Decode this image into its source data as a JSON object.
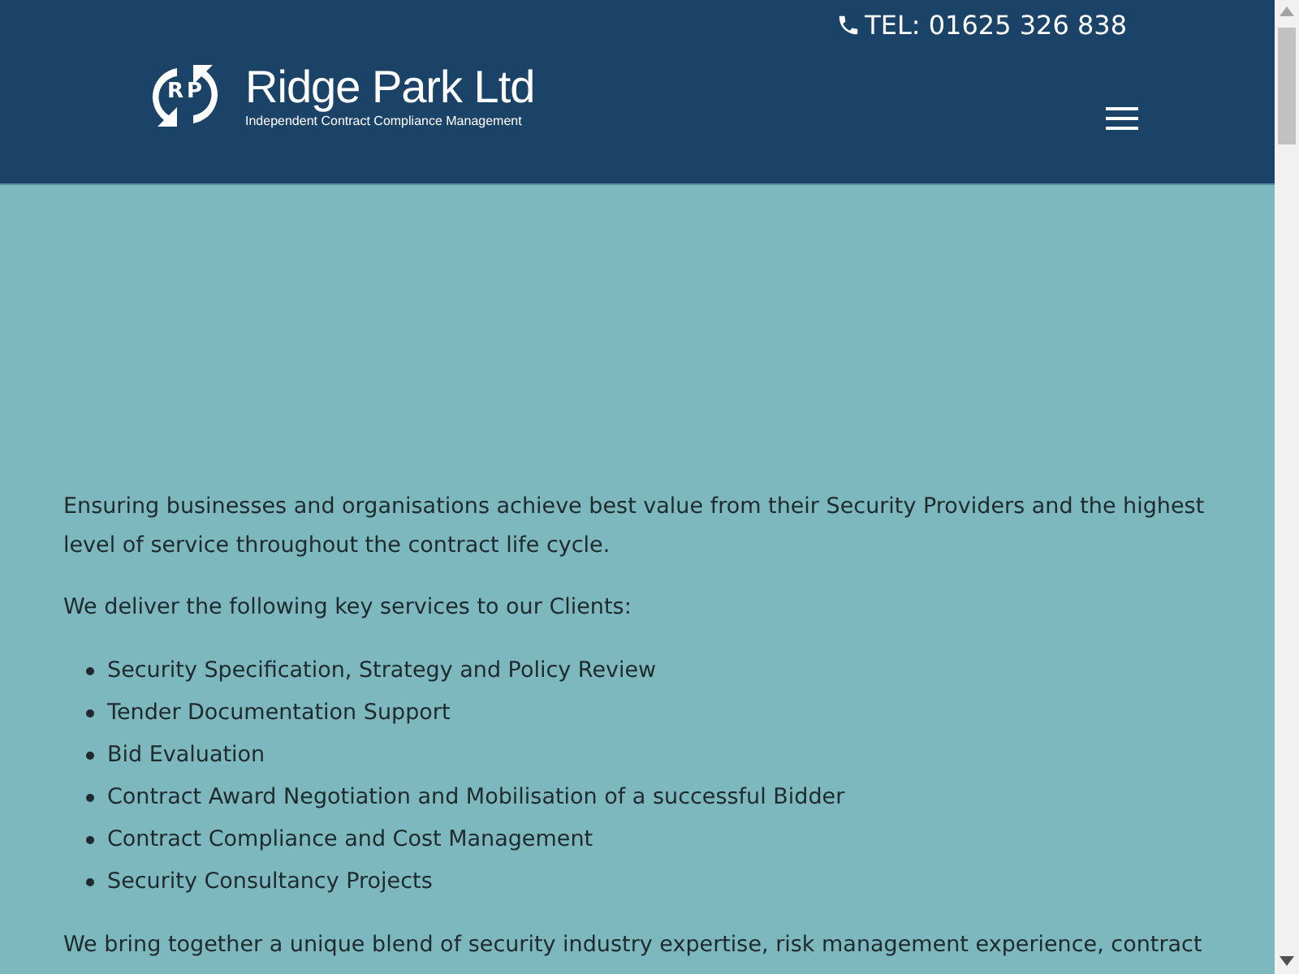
{
  "header": {
    "phone": "TEL: 01625 326 838",
    "logo": {
      "monogram_left": "R",
      "monogram_right": "P",
      "name": "Ridge Park Ltd",
      "tagline": "Independent Contract Compliance Management"
    }
  },
  "content": {
    "intro": "Ensuring businesses and organisations achieve best value from their Security Providers and the highest level of service throughout the contract life cycle.",
    "lead": "We deliver the following key services to our Clients:",
    "services": [
      "Security Specification, Strategy and Policy Review",
      "Tender Documentation Support",
      "Bid Evaluation",
      "Contract Award Negotiation and Mobilisation of a successful Bidder",
      "Contract Compliance and Cost Management",
      "Security Consultancy Projects"
    ],
    "closing": "We bring together a unique blend of security industry expertise, risk management experience, contract"
  }
}
